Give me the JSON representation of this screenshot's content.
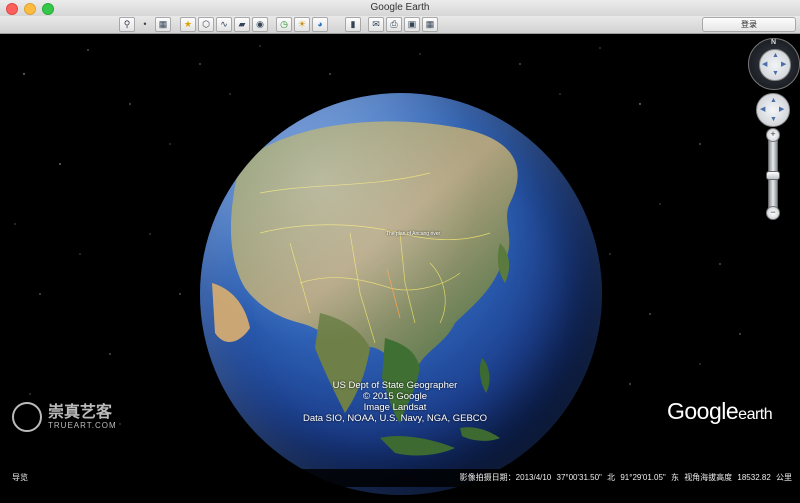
{
  "window": {
    "title": "Google Earth"
  },
  "toolbar": {
    "buttons": [
      {
        "name": "search-toggle-icon"
      },
      {
        "name": "sidebar-toggle-icon"
      },
      {
        "name": "placemark-icon"
      },
      {
        "name": "polygon-icon"
      },
      {
        "name": "path-icon"
      },
      {
        "name": "image-overlay-icon"
      },
      {
        "name": "record-tour-icon"
      },
      {
        "name": "historical-imagery-icon"
      },
      {
        "name": "sunlight-icon"
      },
      {
        "name": "planet-icon"
      },
      {
        "name": "ruler-icon"
      },
      {
        "name": "email-icon"
      },
      {
        "name": "print-icon"
      },
      {
        "name": "save-image-icon"
      },
      {
        "name": "view-in-maps-icon"
      }
    ],
    "login_label": "登录"
  },
  "map": {
    "place_label": "The plan of Ancang river",
    "attribution": [
      "US Dept of State Geographer",
      "© 2015 Google",
      "Image Landsat",
      "Data SIO, NOAA, U.S. Navy, NGA, GEBCO"
    ],
    "logo": {
      "word1": "Google",
      "word2": "earth"
    },
    "watermark": {
      "text": "崇真艺客",
      "sub": "TRUEART.COM"
    }
  },
  "status": {
    "left": "导览",
    "imagery_date": "影像拍摄日期：2013/4/10",
    "lat": "37°00'31.50\" 北",
    "lon": "91°29'01.05\" 东",
    "elevation": "视角海拔高度 18532.82 公里"
  },
  "nav": {
    "north_label": "N"
  },
  "colors": {
    "space": "#000000",
    "ocean": "#2e62b6",
    "borders": "#f5e86a"
  }
}
